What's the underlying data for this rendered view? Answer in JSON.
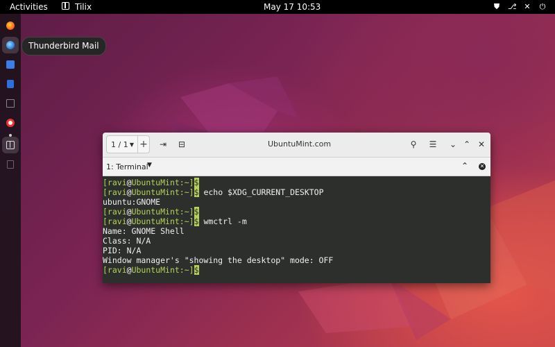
{
  "topbar": {
    "activities": "Activities",
    "app_name": "Tilix",
    "clock": "May 17  10:53"
  },
  "dock": {
    "tooltip": "Thunderbird Mail"
  },
  "window": {
    "title": "UbuntuMint.com",
    "session_label": "1 / 1",
    "tab_label": "1: Terminal"
  },
  "terminal": {
    "lines": [
      {
        "type": "prompt",
        "user": "ravi",
        "host": "UbuntuMint",
        "path": "~",
        "symbol": "$",
        "cmd": ""
      },
      {
        "type": "prompt",
        "user": "ravi",
        "host": "UbuntuMint",
        "path": "~",
        "symbol": "$",
        "cmd": " echo $XDG_CURRENT_DESKTOP"
      },
      {
        "type": "output",
        "text": "ubuntu:GNOME"
      },
      {
        "type": "prompt",
        "user": "ravi",
        "host": "UbuntuMint",
        "path": "~",
        "symbol": "$",
        "cmd": ""
      },
      {
        "type": "prompt",
        "user": "ravi",
        "host": "UbuntuMint",
        "path": "~",
        "symbol": "$",
        "cmd": " wmctrl -m"
      },
      {
        "type": "output",
        "text": "Name: GNOME Shell"
      },
      {
        "type": "output",
        "text": "Class: N/A"
      },
      {
        "type": "output",
        "text": "PID: N/A"
      },
      {
        "type": "output",
        "text": "Window manager's \"showing the desktop\" mode: OFF"
      },
      {
        "type": "prompt",
        "user": "ravi",
        "host": "UbuntuMint",
        "path": "~",
        "symbol": "$",
        "cmd": ""
      }
    ]
  },
  "colors": {
    "prompt": "#b6d25a",
    "terminal_bg": "#2c2f2c"
  }
}
